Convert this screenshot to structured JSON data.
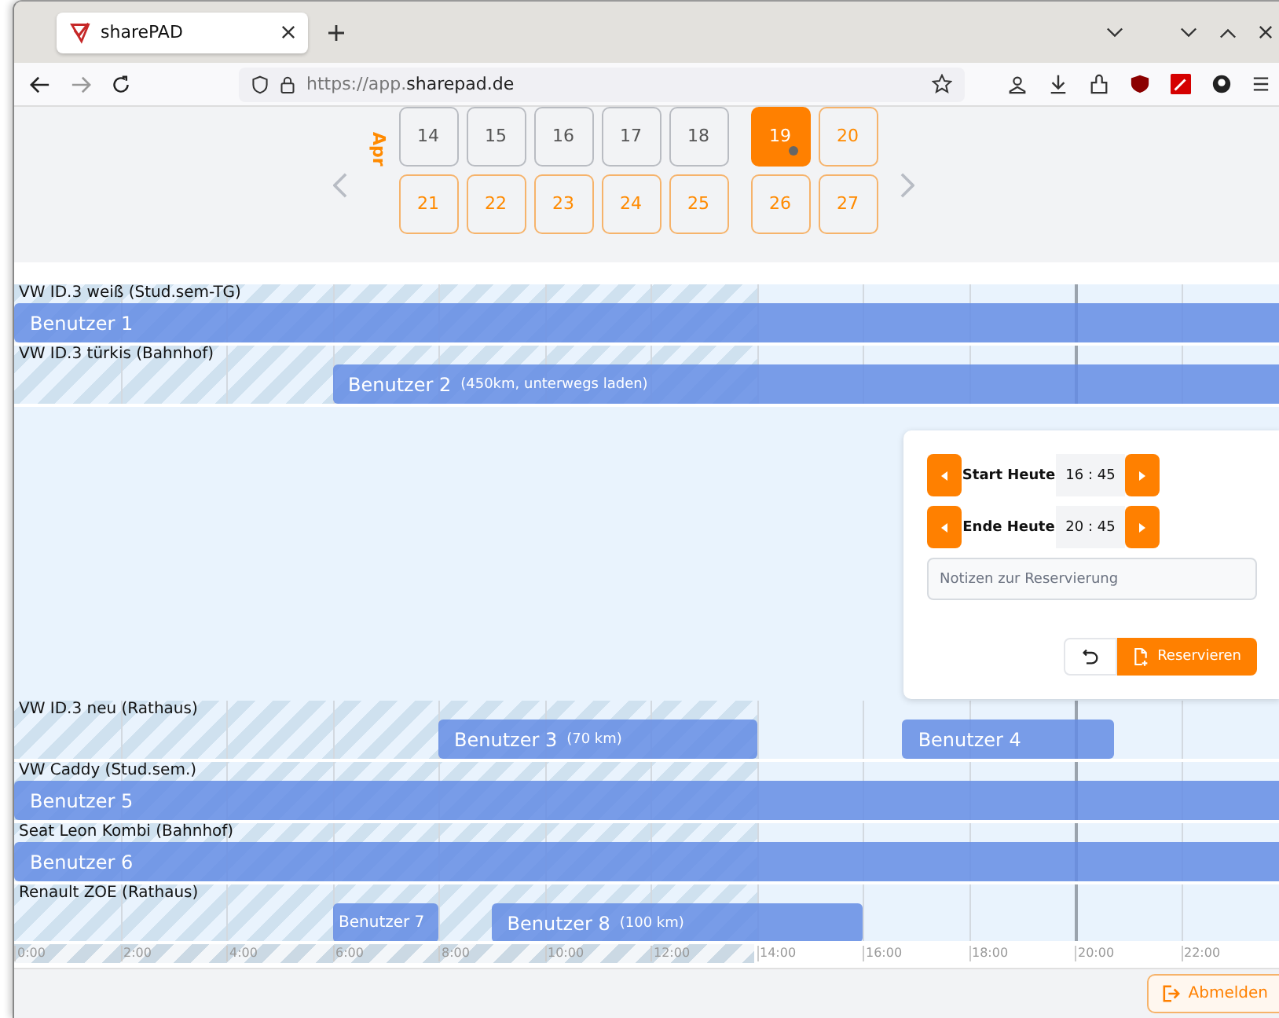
{
  "browser": {
    "tab_title": "sharePAD",
    "url_prefix": "https://app.",
    "url_domain": "sharepad.de"
  },
  "calendar": {
    "month": "Apr",
    "weeks": [
      {
        "weekdays": [
          {
            "label": "14",
            "past": true,
            "selected": false,
            "dot": false
          },
          {
            "label": "15",
            "past": true,
            "selected": false,
            "dot": false
          },
          {
            "label": "16",
            "past": true,
            "selected": false,
            "dot": false
          },
          {
            "label": "17",
            "past": true,
            "selected": false,
            "dot": false
          },
          {
            "label": "18",
            "past": true,
            "selected": false,
            "dot": false
          }
        ],
        "weekend": [
          {
            "label": "19",
            "past": false,
            "selected": true,
            "dot": true
          },
          {
            "label": "20",
            "past": false,
            "selected": false,
            "dot": false
          }
        ]
      },
      {
        "weekdays": [
          {
            "label": "21",
            "past": false,
            "selected": false,
            "dot": false
          },
          {
            "label": "22",
            "past": false,
            "selected": false,
            "dot": false
          },
          {
            "label": "23",
            "past": false,
            "selected": false,
            "dot": false
          },
          {
            "label": "24",
            "past": false,
            "selected": false,
            "dot": false
          },
          {
            "label": "25",
            "past": false,
            "selected": false,
            "dot": false
          }
        ],
        "weekend": [
          {
            "label": "26",
            "past": false,
            "selected": false,
            "dot": false
          },
          {
            "label": "27",
            "past": false,
            "selected": false,
            "dot": false
          }
        ]
      }
    ]
  },
  "timeline": {
    "rows": [
      {
        "vehicle": "VW ID.3 weiß (Stud.sem-TG)",
        "expanded": false,
        "bookings": [
          {
            "user": "Benutzer 1"
          }
        ]
      },
      {
        "vehicle": "VW ID.3 türkis (Bahnhof)",
        "expanded": true,
        "bookings": [
          {
            "user": "Benutzer 2",
            "note": "(450km, unterwegs laden)"
          }
        ]
      },
      {
        "vehicle": "VW ID.3 neu (Rathaus)",
        "expanded": false,
        "bookings": [
          {
            "user": "Benutzer 3",
            "note": "(70 km)"
          },
          {
            "user": "Benutzer 4"
          }
        ]
      },
      {
        "vehicle": "VW Caddy (Stud.sem.)",
        "expanded": false,
        "bookings": [
          {
            "user": "Benutzer 5"
          }
        ]
      },
      {
        "vehicle": "Seat Leon Kombi (Bahnhof)",
        "expanded": false,
        "bookings": [
          {
            "user": "Benutzer 6"
          }
        ]
      },
      {
        "vehicle": "Renault ZOE (Rathaus)",
        "expanded": false,
        "bookings": [
          {
            "user": "Benutzer 7"
          },
          {
            "user": "Benutzer 8",
            "note": "(100 km)"
          }
        ]
      }
    ],
    "axis": [
      "0:00",
      "2:00",
      "4:00",
      "6:00",
      "8:00",
      "10:00",
      "12:00",
      "14:00",
      "16:00",
      "18:00",
      "20:00",
      "22:00"
    ]
  },
  "reservation": {
    "steppers": [
      {
        "label": "Start Heute",
        "time": "16 : 45"
      },
      {
        "label": "Ende Heute",
        "time": "20 : 45"
      }
    ],
    "notes_placeholder": "Notizen zur Reservierung",
    "submit": "Reservieren"
  },
  "logout": "Abmelden"
}
